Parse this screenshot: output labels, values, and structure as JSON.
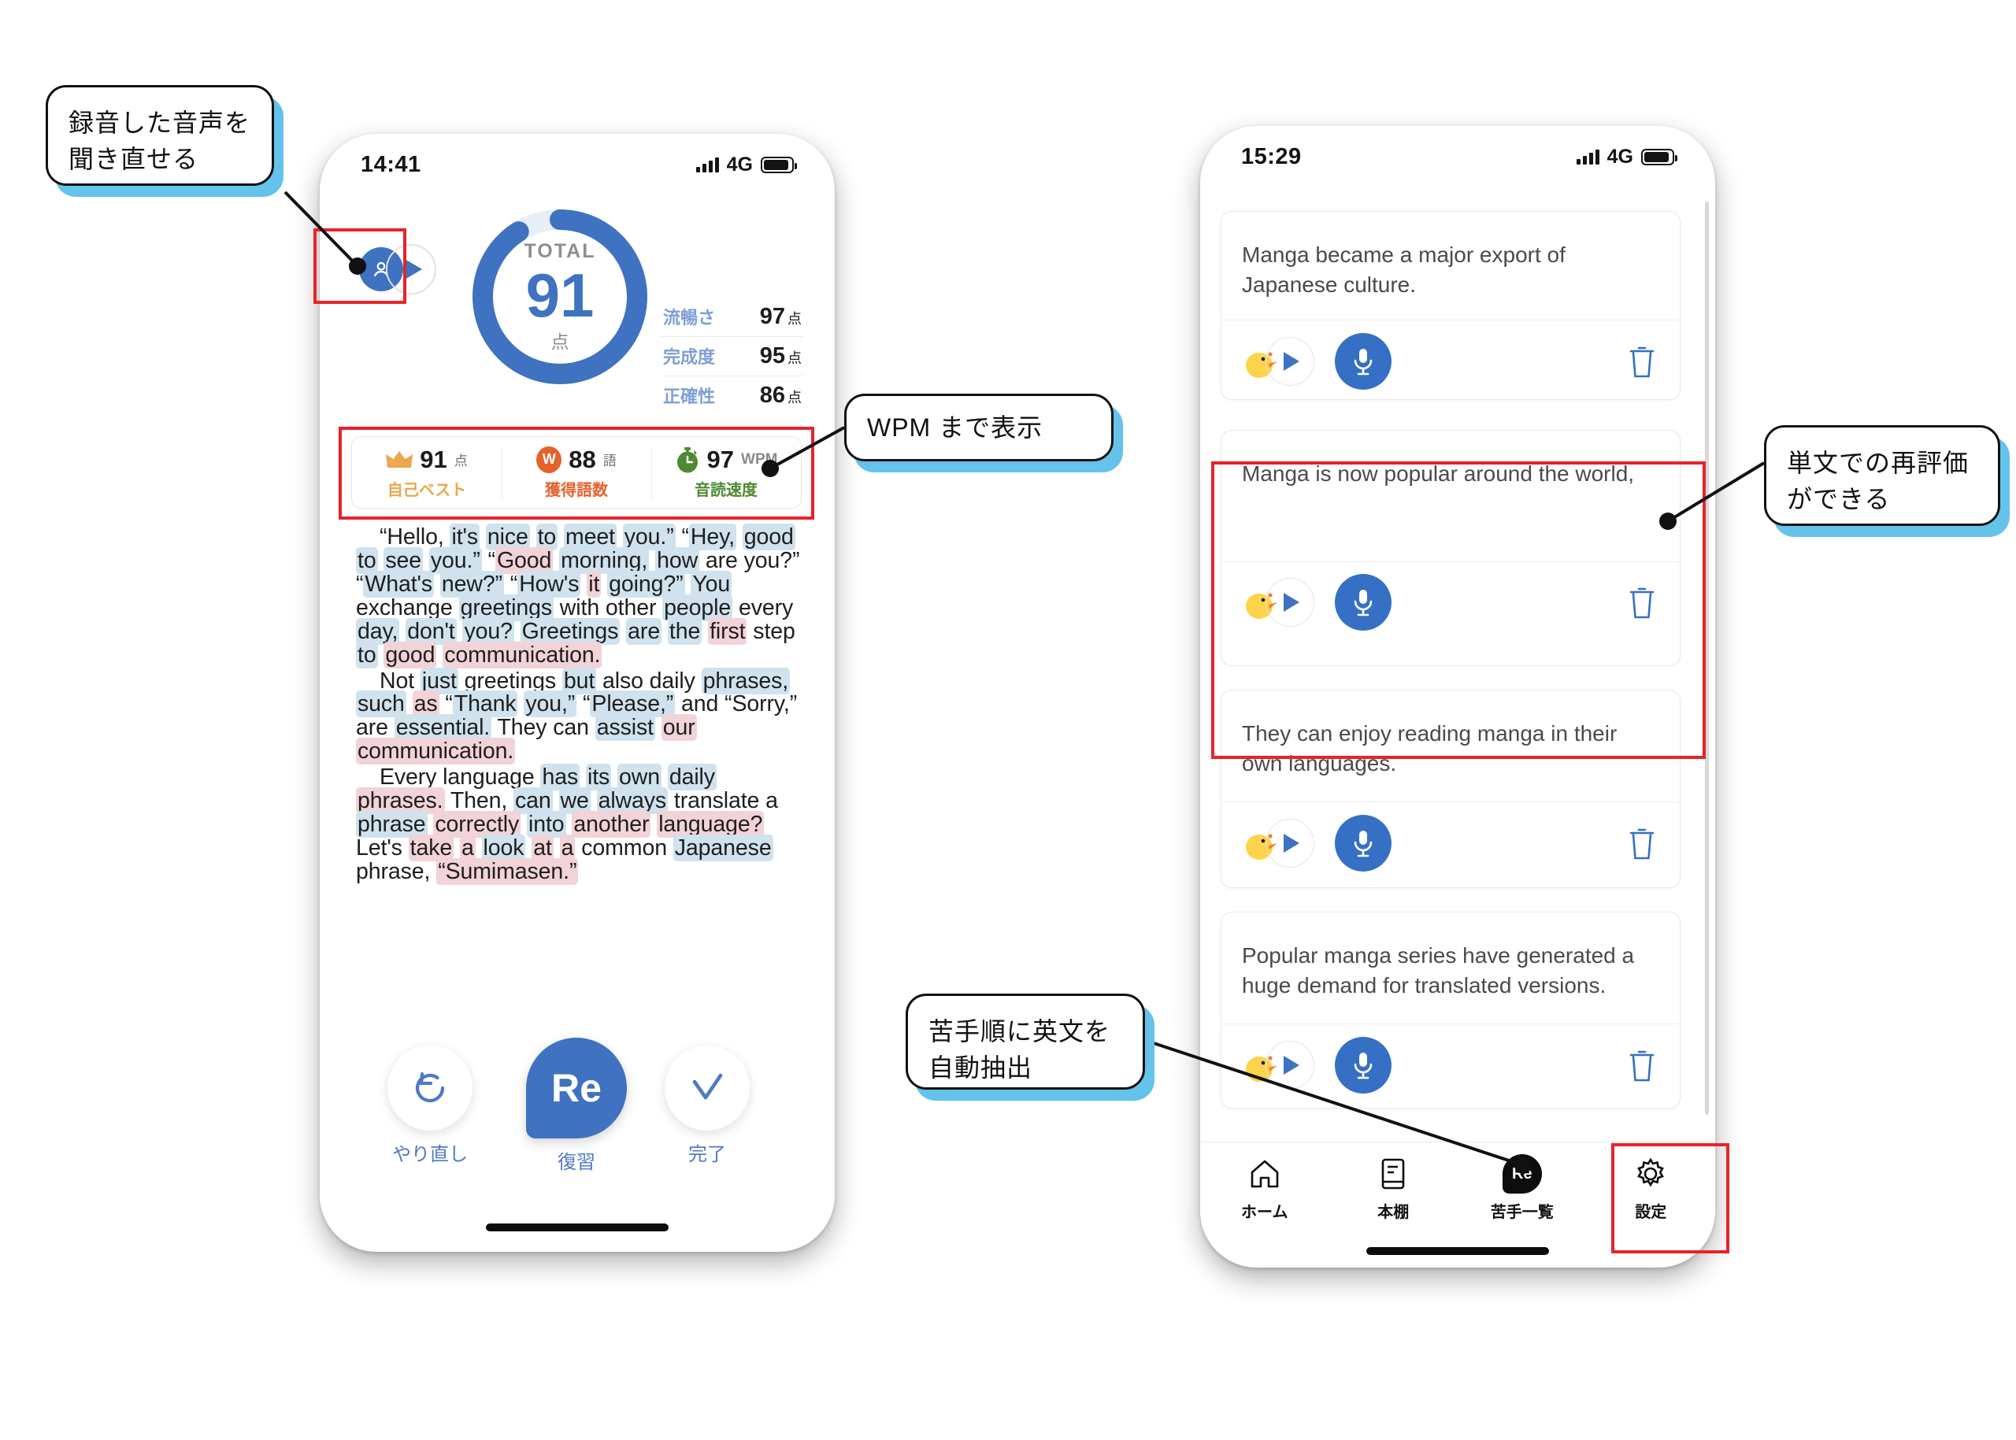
{
  "callouts": [
    {
      "id": "co1",
      "text": "録音した音声を\n聞き直せる"
    },
    {
      "id": "co2",
      "text": "WPM まで表示"
    },
    {
      "id": "co3",
      "text": "単文での再評価\nができる"
    },
    {
      "id": "co4",
      "text": "苦手順に英文を\n自動抽出"
    }
  ],
  "phone1": {
    "status": {
      "time": "14:41",
      "network": "4G"
    },
    "player": {
      "avatar_icon": "account-circle-icon",
      "play_icon": "play-icon"
    },
    "score_ring": {
      "caption": "TOTAL",
      "value": "91",
      "unit": "点",
      "percent": 91,
      "ring_color": "#3f72c0",
      "track_color": "#e7eef8"
    },
    "subscores": [
      {
        "label": "流暢さ",
        "value": "97",
        "unit": "点"
      },
      {
        "label": "完成度",
        "value": "95",
        "unit": "点"
      },
      {
        "label": "正確性",
        "value": "86",
        "unit": "点"
      }
    ],
    "stats": [
      {
        "icon": "crown-icon",
        "value": "91",
        "unit": "点",
        "caption": "自己ベスト",
        "color": "#eaa74b"
      },
      {
        "icon": "word-count-icon",
        "badge": "W",
        "value": "88",
        "unit": "語",
        "caption": "獲得語数",
        "color": "#e4622c"
      },
      {
        "icon": "stopwatch-icon",
        "value": "97",
        "unit": "WPM",
        "caption": "音読速度",
        "color": "#4e8a33"
      }
    ],
    "passage": [
      "“Hello, it's nice to meet you.” “Hey, good to see you.” “Good morning, how are you?” “What's new?” “How's it going?” You exchange greetings with other people every day, don't you? Greetings are the first step to good communication.",
      "Not just greetings but also daily phrases, such as “Thank you,” “Please,” and “Sorry,” are essential. They can assist our communication.",
      "Every language has its own daily phrases. Then, can we always translate a phrase correctly into another language? Let's take a look at a common Japanese phrase, “Sumimasen.”"
    ],
    "actions": [
      {
        "icon": "redo-icon",
        "label": "やり直し"
      },
      {
        "icon": "re-bubble-icon",
        "badge": "Re",
        "label": "復習"
      },
      {
        "icon": "check-icon",
        "label": "完了"
      }
    ]
  },
  "phone2": {
    "status": {
      "time": "15:29",
      "network": "4G"
    },
    "cards": [
      {
        "text": "Manga became a major export of Japanese culture.",
        "play_icon": "chick-play-icon",
        "record_icon": "microphone-icon",
        "delete_icon": "trash-icon"
      },
      {
        "text": "Manga is now popular around the world,",
        "play_icon": "chick-play-icon",
        "record_icon": "microphone-icon",
        "delete_icon": "trash-icon"
      },
      {
        "text": "They can enjoy reading manga in their own languages.",
        "play_icon": "chick-play-icon",
        "record_icon": "microphone-icon",
        "delete_icon": "trash-icon"
      },
      {
        "text": "Popular manga series have generated a huge demand for translated versions.",
        "play_icon": "chick-play-icon",
        "record_icon": "microphone-icon",
        "delete_icon": "trash-icon"
      }
    ],
    "tabs": [
      {
        "icon": "home-icon",
        "label": "ホーム",
        "selected": false
      },
      {
        "icon": "bookshelf-icon",
        "label": "本棚",
        "selected": false
      },
      {
        "icon": "re-bubble-icon",
        "badge": "Re",
        "label": "苦手一覧",
        "selected": true
      },
      {
        "icon": "gear-icon",
        "label": "設定",
        "selected": false
      }
    ]
  }
}
